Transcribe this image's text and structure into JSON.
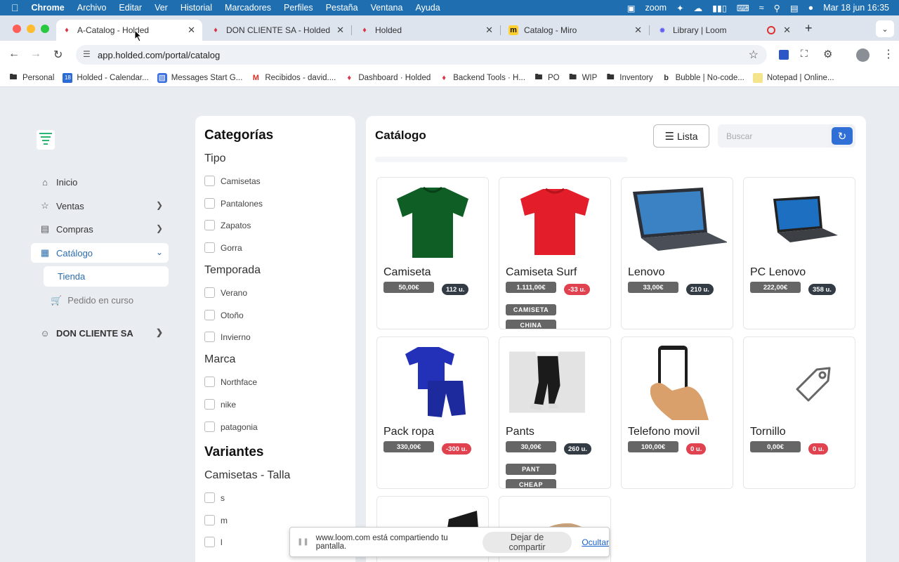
{
  "menubar": {
    "app": "Chrome",
    "items": [
      "Archivo",
      "Editar",
      "Ver",
      "Historial",
      "Marcadores",
      "Perfiles",
      "Pestaña",
      "Ventana",
      "Ayuda"
    ],
    "zoom": "zoom",
    "datetime": "Mar 18 jun 16:35"
  },
  "tabs": [
    {
      "title": "A-Catalog - Holded",
      "active": true
    },
    {
      "title": "DON CLIENTE SA - Holded"
    },
    {
      "title": "Holded"
    },
    {
      "title": "Catalog - Miro"
    },
    {
      "title": "Library | Loom"
    }
  ],
  "toolbar": {
    "url": "app.holded.com/portal/catalog"
  },
  "bookmarks": [
    "Personal",
    "Holded - Calendar...",
    "Messages Start G...",
    "Recibidos - david....",
    "Dashboard · Holded",
    "Backend Tools · H...",
    "PO",
    "WIP",
    "Inventory",
    "Bubble | No-code...",
    "Notepad | Online..."
  ],
  "sidebar": {
    "items": [
      {
        "label": "Inicio",
        "icon": "home-icon"
      },
      {
        "label": "Ventas",
        "icon": "star-icon"
      },
      {
        "label": "Compras",
        "icon": "bag-icon"
      },
      {
        "label": "Catálogo",
        "icon": "catalog-icon"
      }
    ],
    "sub": [
      {
        "label": "Tienda"
      },
      {
        "label": "Pedido en curso",
        "icon": "cart-icon"
      }
    ],
    "account": "DON CLIENTE SA"
  },
  "categories": {
    "title": "Categorías",
    "tipo": {
      "label": "Tipo",
      "options": [
        "Camisetas",
        "Pantalones",
        "Zapatos",
        "Gorra"
      ]
    },
    "temporada": {
      "label": "Temporada",
      "options": [
        "Verano",
        "Otoño",
        "Invierno"
      ]
    },
    "marca": {
      "label": "Marca",
      "options": [
        "Northface",
        "nike",
        "patagonia"
      ]
    },
    "variantes": {
      "title": "Variantes",
      "group": "Camisetas - Talla",
      "options": [
        "s",
        "m",
        "l"
      ]
    }
  },
  "catalog": {
    "title": "Catálogo",
    "list_label": "Lista",
    "search_placeholder": "Buscar",
    "products": [
      {
        "name": "Camiseta",
        "price": "50,00€",
        "stock": "112 u.",
        "tags": []
      },
      {
        "name": "Camiseta Surf",
        "price": "1.111,00€",
        "stock": "-33 u.",
        "tags": [
          "CAMISETA",
          "CHINA"
        ]
      },
      {
        "name": "Lenovo",
        "price": "33,00€",
        "stock": "210 u.",
        "tags": []
      },
      {
        "name": "PC Lenovo",
        "price": "222,00€",
        "stock": "358 u.",
        "tags": []
      },
      {
        "name": "Pack ropa",
        "price": "330,00€",
        "stock": "-300 u.",
        "tags": []
      },
      {
        "name": "Pants",
        "price": "30,00€",
        "stock": "260 u.",
        "tags": [
          "PANT",
          "CHEAP"
        ]
      },
      {
        "name": "Telefono movil",
        "price": "100,00€",
        "stock": "0 u.",
        "tags": []
      },
      {
        "name": "Tornillo",
        "price": "0,00€",
        "stock": "0 u.",
        "tags": []
      }
    ]
  },
  "sharebar": {
    "message": "www.loom.com está compartiendo tu pantalla.",
    "stop": "Dejar de compartir",
    "hide": "Ocultar"
  },
  "colors": {
    "accent": "#2b6cb0",
    "stock_ok": "#333b45",
    "stock_bad": "#e0424f"
  }
}
